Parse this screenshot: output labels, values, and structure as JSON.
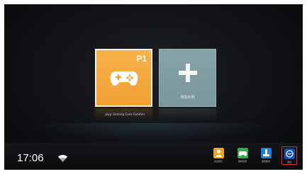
{
  "tiles": {
    "game": {
      "badge": "P1",
      "caption": "Joyp Gnming Coro Cotntier",
      "icon": "gamepad-icon",
      "color": "#f0a033"
    },
    "add": {
      "label": "增加手柄",
      "icon": "plus-icon",
      "color": "#7a989c"
    }
  },
  "status_bar": {
    "time": "17:06",
    "wifi_icon": "wifi-icon"
  },
  "tray": [
    {
      "label": "关注我们",
      "icon": "person-icon",
      "color": "#f2a31c"
    },
    {
      "label": "我的应用",
      "icon": "gamepad-small-icon",
      "color": "#38a848"
    },
    {
      "label": "连接模式",
      "icon": "connect-icon",
      "color": "#1f7ed8"
    },
    {
      "label": "退出",
      "icon": "exit-icon",
      "color": "#1a4fa8",
      "selected": true
    }
  ]
}
